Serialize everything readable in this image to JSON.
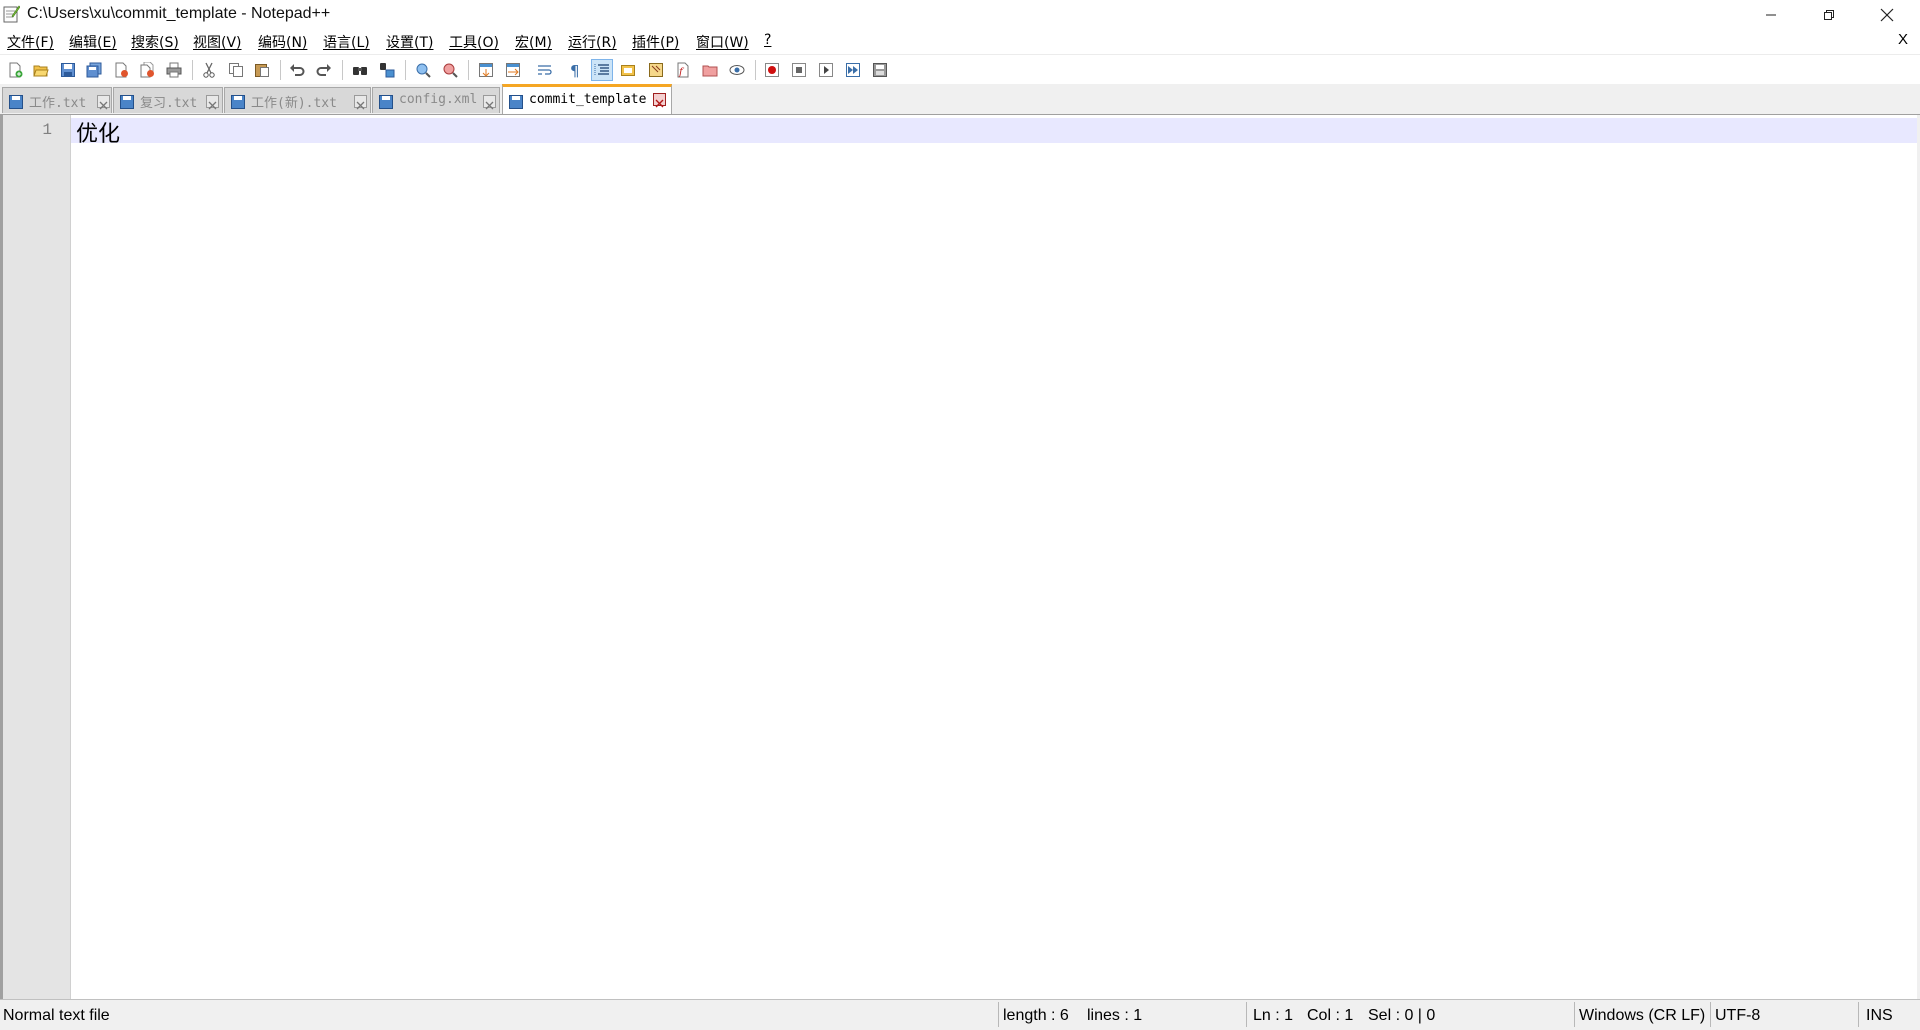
{
  "window": {
    "title": "C:\\Users\\xu\\commit_template - Notepad++",
    "menu_close_label": "X"
  },
  "menu": [
    {
      "label": "文件(F)"
    },
    {
      "label": "编辑(E)"
    },
    {
      "label": "搜索(S)"
    },
    {
      "label": "视图(V)"
    },
    {
      "label": "编码(N)"
    },
    {
      "label": "语言(L)"
    },
    {
      "label": "设置(T)"
    },
    {
      "label": "工具(O)"
    },
    {
      "label": "宏(M)"
    },
    {
      "label": "运行(R)"
    },
    {
      "label": "插件(P)"
    },
    {
      "label": "窗口(W)"
    },
    {
      "label": "?"
    }
  ],
  "toolbar": {
    "buttons": [
      "new-file-icon",
      "open-file-icon",
      "save-icon",
      "save-all-icon",
      "close-icon",
      "close-all-icon",
      "print-icon",
      "cut-icon",
      "copy-icon",
      "paste-icon",
      "undo-icon",
      "redo-icon",
      "find-icon",
      "replace-icon",
      "zoom-in-icon",
      "zoom-out-icon",
      "sync-vertical-icon",
      "sync-horizontal-icon",
      "word-wrap-icon",
      "show-all-chars-icon",
      "indent-guide-icon",
      "language-icon",
      "doc-map-icon",
      "function-list-icon",
      "folder-as-workspace-icon",
      "monitoring-icon",
      "record-macro-icon",
      "stop-record-icon",
      "playback-macro-icon",
      "run-macro-multiple-icon",
      "save-macro-icon"
    ]
  },
  "tabs": [
    {
      "label": "工作.txt",
      "active": false
    },
    {
      "label": "复习.txt",
      "active": false
    },
    {
      "label": "工作(新).txt",
      "active": false
    },
    {
      "label": "config.xml",
      "active": false
    },
    {
      "label": "commit_template",
      "active": true
    }
  ],
  "editor": {
    "lines": [
      {
        "number": "1",
        "text": "优化"
      }
    ]
  },
  "status": {
    "file_type": "Normal text file",
    "length": "length : 6",
    "lines": "lines : 1",
    "ln": "Ln : 1",
    "col": "Col : 1",
    "sel": "Sel : 0 | 0",
    "eol": "Windows (CR LF)",
    "encoding": "UTF-8",
    "mode": "INS"
  },
  "colors": {
    "active_tab_accent": "#f5a623",
    "current_line": "#e8e8ff",
    "gutter": "#e4e4e4"
  }
}
